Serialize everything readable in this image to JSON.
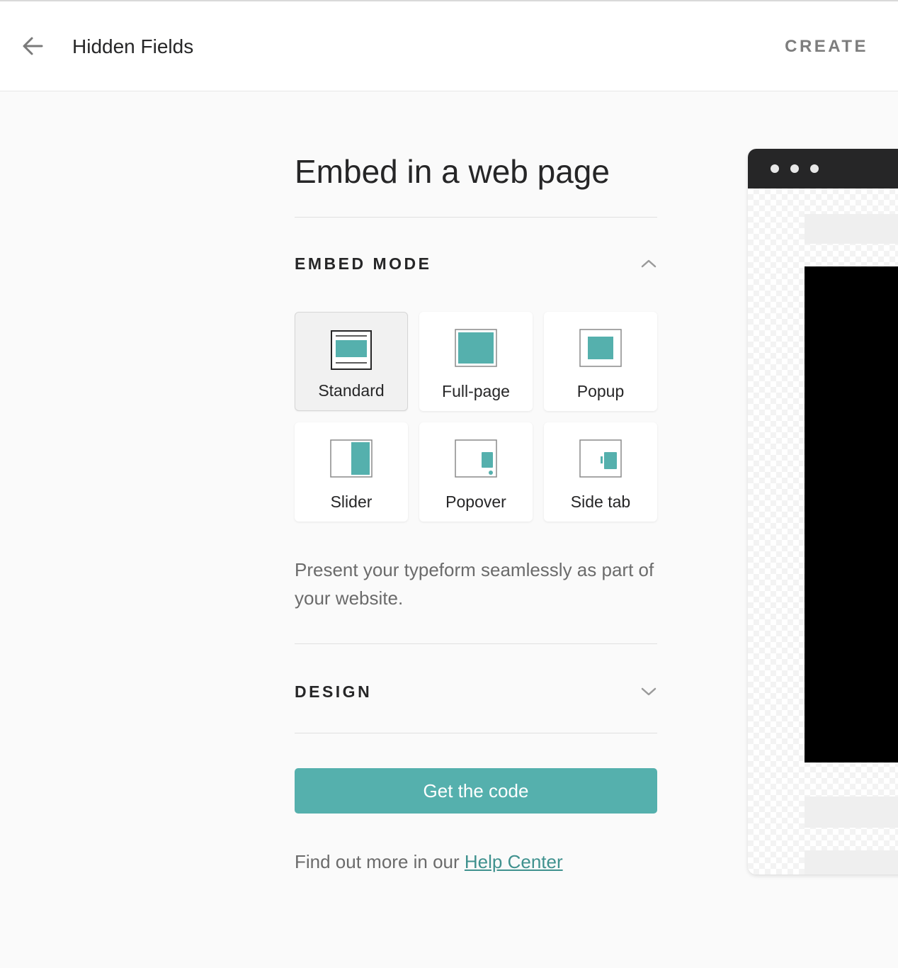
{
  "header": {
    "back_icon": "arrow-left-icon",
    "title": "Hidden Fields",
    "create_label": "CREATE"
  },
  "main": {
    "page_title": "Embed in a web page",
    "embed_mode": {
      "label": "EMBED MODE",
      "expanded": true,
      "selected": "Standard",
      "modes": [
        {
          "label": "Standard",
          "icon": "standard-embed-icon"
        },
        {
          "label": "Full-page",
          "icon": "full-page-embed-icon"
        },
        {
          "label": "Popup",
          "icon": "popup-embed-icon"
        },
        {
          "label": "Slider",
          "icon": "slider-embed-icon"
        },
        {
          "label": "Popover",
          "icon": "popover-embed-icon"
        },
        {
          "label": "Side tab",
          "icon": "side-tab-embed-icon"
        }
      ],
      "description": "Present your typeform seamlessly as part of your website."
    },
    "design": {
      "label": "DESIGN",
      "expanded": false
    },
    "cta_label": "Get the code",
    "help": {
      "prefix": "Find out more in our ",
      "link": "Help Center"
    }
  },
  "colors": {
    "accent": "#55b0ad",
    "link": "#3f918e",
    "text": "#262627",
    "muted": "#6b6b6b"
  }
}
